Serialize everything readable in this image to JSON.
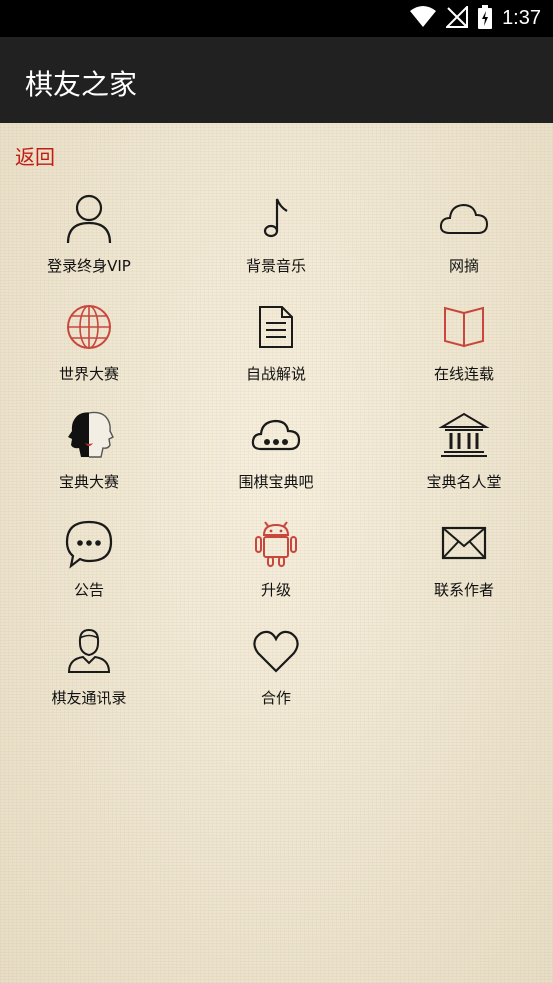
{
  "status_bar": {
    "time": "1:37",
    "icons": [
      "wifi-icon",
      "no-signal-icon",
      "battery-charging-icon"
    ]
  },
  "app_bar": {
    "title": "棋友之家"
  },
  "back_label": "返回",
  "colors": {
    "accent_red": "#c21d12",
    "icon_red": "#c9463d",
    "icon_dark": "#1a1a1a"
  },
  "menu_items": [
    {
      "label": "登录终身VIP",
      "icon": "person-icon"
    },
    {
      "label": "背景音乐",
      "icon": "music-note-icon"
    },
    {
      "label": "网摘",
      "icon": "cloud-icon"
    },
    {
      "label": "世界大赛",
      "icon": "globe-icon"
    },
    {
      "label": "自战解说",
      "icon": "document-icon"
    },
    {
      "label": "在线连载",
      "icon": "open-book-icon"
    },
    {
      "label": "宝典大赛",
      "icon": "two-faces-icon"
    },
    {
      "label": "围棋宝典吧",
      "icon": "cloud-chat-icon"
    },
    {
      "label": "宝典名人堂",
      "icon": "museum-icon"
    },
    {
      "label": "公告",
      "icon": "chat-bubble-icon"
    },
    {
      "label": "升级",
      "icon": "android-icon"
    },
    {
      "label": "联系作者",
      "icon": "envelope-icon"
    },
    {
      "label": "棋友通讯录",
      "icon": "contact-person-icon"
    },
    {
      "label": "合作",
      "icon": "heart-icon"
    }
  ]
}
